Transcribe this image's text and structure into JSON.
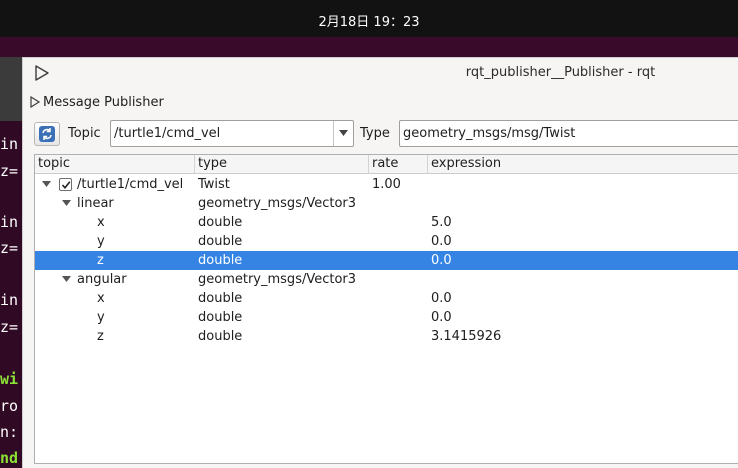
{
  "system": {
    "clock": "2月18日  19：23"
  },
  "terminal": {
    "lines": [
      {
        "text": "in",
        "style": "plain"
      },
      {
        "text": "z=",
        "style": "plain"
      },
      {
        "text": "in",
        "style": "plain"
      },
      {
        "text": "z=",
        "style": "plain"
      },
      {
        "text": "in",
        "style": "plain"
      },
      {
        "text": "z=",
        "style": "plain"
      },
      {
        "text": "wi",
        "style": "green"
      },
      {
        "text": "ro",
        "style": "plain"
      },
      {
        "text": "n:",
        "style": "plain"
      },
      {
        "text": "nd",
        "style": "green"
      }
    ]
  },
  "window": {
    "title": "rqt_publisher__Publisher - rqt",
    "plugin_label": "Message Publisher"
  },
  "toolbar": {
    "topic_label": "Topic",
    "topic_value": "/turtle1/cmd_vel",
    "type_label": "Type",
    "type_value": "geometry_msgs/msg/Twist"
  },
  "tree": {
    "headers": {
      "topic": "topic",
      "type": "type",
      "rate": "rate",
      "expression": "expression"
    },
    "rows": [
      {
        "name": "/turtle1/cmd_vel",
        "type": "Twist",
        "rate": "1.00",
        "expression": "",
        "level": 0,
        "expanded": true,
        "checked": true,
        "selected": false
      },
      {
        "name": "linear",
        "type": "geometry_msgs/Vector3",
        "rate": "",
        "expression": "",
        "level": 1,
        "expanded": true,
        "checked": false,
        "selected": false
      },
      {
        "name": "x",
        "type": "double",
        "rate": "",
        "expression": "5.0",
        "level": 2,
        "expanded": false,
        "checked": false,
        "selected": false
      },
      {
        "name": "y",
        "type": "double",
        "rate": "",
        "expression": "0.0",
        "level": 2,
        "expanded": false,
        "checked": false,
        "selected": false
      },
      {
        "name": "z",
        "type": "double",
        "rate": "",
        "expression": "0.0",
        "level": 2,
        "expanded": false,
        "checked": false,
        "selected": true
      },
      {
        "name": "angular",
        "type": "geometry_msgs/Vector3",
        "rate": "",
        "expression": "",
        "level": 1,
        "expanded": true,
        "checked": false,
        "selected": false
      },
      {
        "name": "x",
        "type": "double",
        "rate": "",
        "expression": "0.0",
        "level": 2,
        "expanded": false,
        "checked": false,
        "selected": false
      },
      {
        "name": "y",
        "type": "double",
        "rate": "",
        "expression": "0.0",
        "level": 2,
        "expanded": false,
        "checked": false,
        "selected": false
      },
      {
        "name": "z",
        "type": "double",
        "rate": "",
        "expression": "3.1415926",
        "level": 2,
        "expanded": false,
        "checked": false,
        "selected": false
      }
    ]
  }
}
